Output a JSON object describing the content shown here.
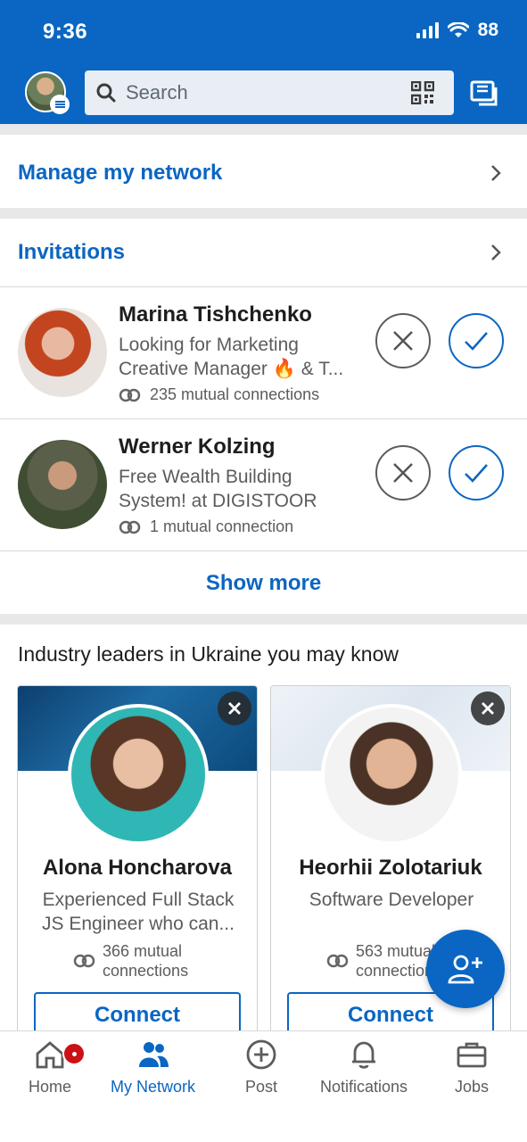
{
  "status_bar": {
    "time": "9:36",
    "battery": "88"
  },
  "search": {
    "placeholder": "Search"
  },
  "manage": {
    "label": "Manage my network"
  },
  "invitations": {
    "label": "Invitations",
    "items": [
      {
        "name": "Marina Tishchenko",
        "headline_line1": "Looking for Marketing",
        "headline_line2": "Creative Manager 🔥 & T...",
        "mutual": "235 mutual connections"
      },
      {
        "name": "Werner Kolzing",
        "headline_line1": "Free Wealth Building",
        "headline_line2": "System! at DIGISTOOR",
        "mutual": "1 mutual connection"
      }
    ],
    "show_more": "Show more"
  },
  "suggestions": {
    "title": "Industry leaders in Ukraine you may know",
    "cards": [
      {
        "name": "Alona Honcharova",
        "headline_line1": "Experienced Full Stack",
        "headline_line2": "JS Engineer who can...",
        "mutual_line1": "366 mutual",
        "mutual_line2": "connections",
        "connect": "Connect"
      },
      {
        "name": "Heorhii Zolotariuk",
        "headline_line1": "Software Developer",
        "headline_line2": "",
        "mutual_line1": "563 mutual",
        "mutual_line2": "connections",
        "connect": "Connect"
      }
    ]
  },
  "bottom_nav": {
    "items": [
      {
        "label": "Home",
        "icon": "home-icon"
      },
      {
        "label": "My Network",
        "icon": "people-icon"
      },
      {
        "label": "Post",
        "icon": "plus-circle-icon"
      },
      {
        "label": "Notifications",
        "icon": "bell-icon"
      },
      {
        "label": "Jobs",
        "icon": "briefcase-icon"
      }
    ]
  },
  "colors": {
    "brand": "#0a66c2",
    "badge": "#cc1016"
  }
}
